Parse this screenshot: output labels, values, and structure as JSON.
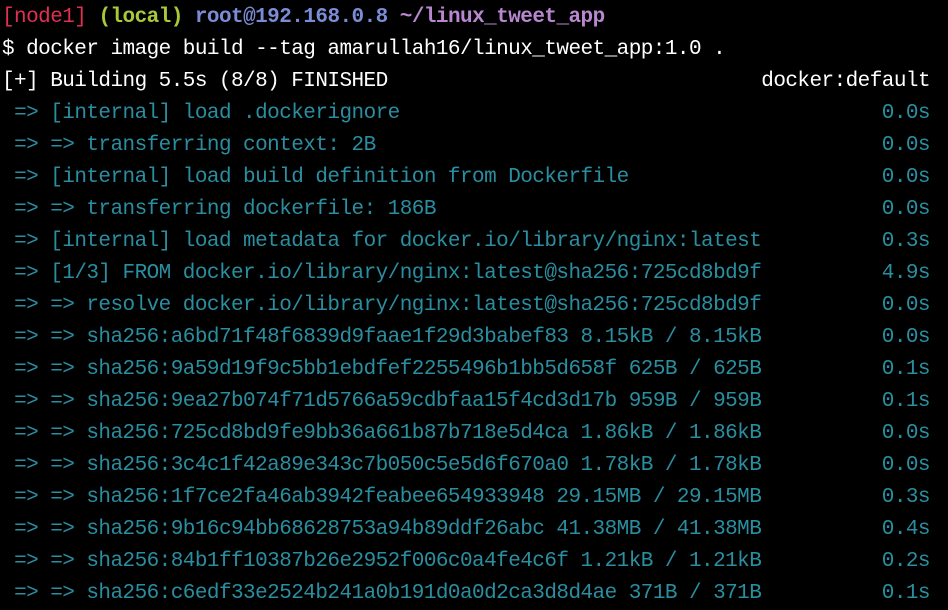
{
  "prompt": {
    "node": "[node1]",
    "env": "(local)",
    "user_host": "root@192.168.0.8",
    "path": "~/linux_tweet_app"
  },
  "command": "$ docker image build --tag amarullah16/linux_tweet_app:1.0 .",
  "build_status": {
    "text": "[+] Building 5.5s (8/8) FINISHED",
    "builder": "docker:default"
  },
  "steps": [
    {
      "text": "=> [internal] load .dockerignore",
      "time": "0.0s"
    },
    {
      "text": "=> => transferring context: 2B",
      "time": "0.0s"
    },
    {
      "text": "=> [internal] load build definition from Dockerfile",
      "time": "0.0s"
    },
    {
      "text": "=> => transferring dockerfile: 186B",
      "time": "0.0s"
    },
    {
      "text": "=> [internal] load metadata for docker.io/library/nginx:latest",
      "time": "0.3s"
    },
    {
      "text": "=> [1/3] FROM docker.io/library/nginx:latest@sha256:725cd8bd9f",
      "time": "4.9s"
    },
    {
      "text": "=> => resolve docker.io/library/nginx:latest@sha256:725cd8bd9f",
      "time": "0.0s"
    },
    {
      "text": "=> => sha256:a6bd71f48f6839d9faae1f29d3babef83 8.15kB / 8.15kB",
      "time": "0.0s"
    },
    {
      "text": "=> => sha256:9a59d19f9c5bb1ebdfef2255496b1bb5d658f 625B / 625B",
      "time": "0.1s"
    },
    {
      "text": "=> => sha256:9ea27b074f71d5766a59cdbfaa15f4cd3d17b 959B / 959B",
      "time": "0.1s"
    },
    {
      "text": "=> => sha256:725cd8bd9fe9bb36a661b87b718e5d4ca 1.86kB / 1.86kB",
      "time": "0.0s"
    },
    {
      "text": "=> => sha256:3c4c1f42a89e343c7b050c5e5d6f670a0 1.78kB / 1.78kB",
      "time": "0.0s"
    },
    {
      "text": "=> => sha256:1f7ce2fa46ab3942feabee654933948 29.15MB / 29.15MB",
      "time": "0.3s"
    },
    {
      "text": "=> => sha256:9b16c94bb68628753a94b89ddf26abc 41.38MB / 41.38MB",
      "time": "0.4s"
    },
    {
      "text": "=> => sha256:84b1ff10387b26e2952f006c0a4fe4c6f 1.21kB / 1.21kB",
      "time": "0.2s"
    },
    {
      "text": "=> => sha256:c6edf33e2524b241a0b191d0a0d2ca3d8d4ae 371B / 371B",
      "time": "0.1s"
    }
  ]
}
